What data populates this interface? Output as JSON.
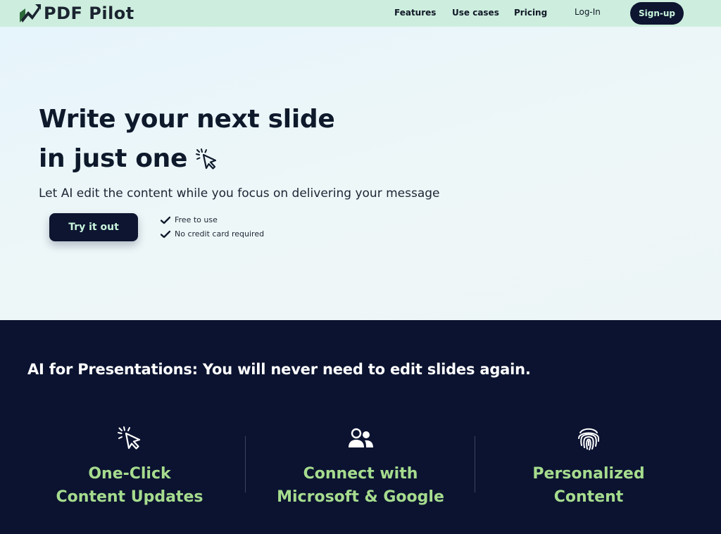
{
  "header": {
    "logo_text": "PDF Pilot",
    "nav": {
      "features": "Features",
      "use_cases": "Use cases",
      "pricing": "Pricing",
      "login": "Log-In",
      "signup": "Sign-up"
    }
  },
  "hero": {
    "title_line1": "Write your next slide",
    "title_line2": "in just one",
    "subtitle": "Let AI edit the content while you focus on delivering your message",
    "cta": "Try it out",
    "checks": [
      "Free to use",
      "No credit card required"
    ],
    "icon": "click-cursor-icon"
  },
  "features": {
    "heading": "AI for Presentations: You will never need to edit slides again.",
    "items": [
      {
        "label": "One-Click\nContent Updates",
        "icon": "click-cursor-icon"
      },
      {
        "label": "Connect with\nMicrosoft & Google",
        "icon": "users-icon"
      },
      {
        "label": "Personalized\nContent",
        "icon": "fingerprint-icon"
      }
    ]
  },
  "colors": {
    "header_bg": "#cdeede",
    "dark_navy": "#0b1330",
    "accent_green": "#a6dc8e",
    "button_text": "#c9f5dd"
  }
}
